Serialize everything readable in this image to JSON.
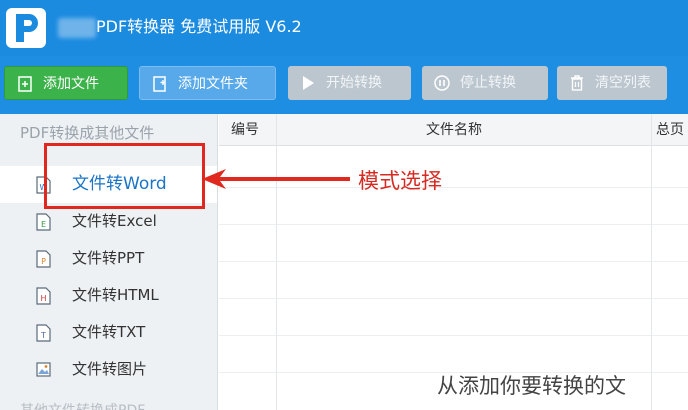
{
  "window": {
    "title": "PDF转换器 免费试用版 V6.2",
    "accent": "#1b8be0"
  },
  "toolbar": {
    "add_file": "添加文件",
    "add_folder": "添加文件夹",
    "start": "开始转换",
    "stop": "停止转换",
    "clear": "清空列表"
  },
  "sidebar": {
    "section_title": "PDF转换成其他文件",
    "items": [
      {
        "label": "文件转Word",
        "icon": "word-file-icon",
        "active": true
      },
      {
        "label": "文件转Excel",
        "icon": "excel-file-icon"
      },
      {
        "label": "文件转PPT",
        "icon": "ppt-file-icon"
      },
      {
        "label": "文件转HTML",
        "icon": "html-file-icon"
      },
      {
        "label": "文件转TXT",
        "icon": "txt-file-icon"
      },
      {
        "label": "文件转图片",
        "icon": "image-file-icon"
      }
    ],
    "footer_partial": "其他文件转换成PDF"
  },
  "table": {
    "columns": [
      "编号",
      "文件名称",
      "总页"
    ],
    "empty_hint": "从添加你要转换的文"
  },
  "annotation": {
    "text": "模式选择",
    "color": "#e0281f"
  }
}
